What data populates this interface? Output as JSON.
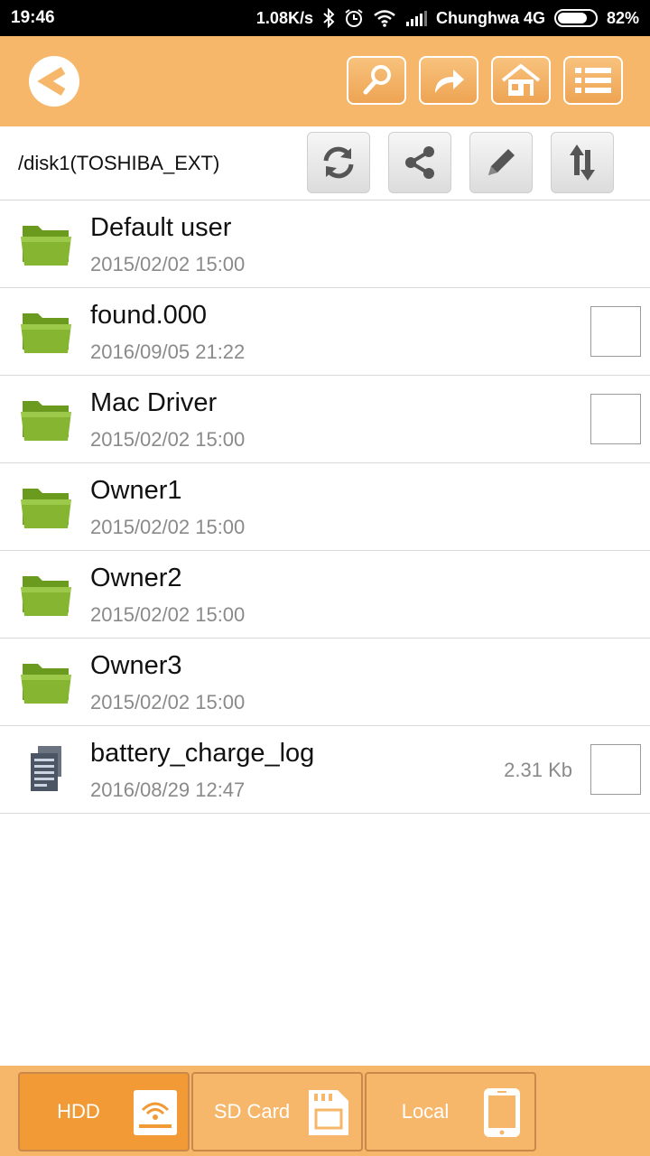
{
  "status": {
    "time": "19:46",
    "speed": "1.08K/s",
    "carrier": "Chunghwa 4G",
    "battery": "82%",
    "battery_level": 0.82
  },
  "toolbar": {
    "buttons": [
      {
        "name": "search-button",
        "icon": "key-icon"
      },
      {
        "name": "share-forward-button",
        "icon": "forward-arrow-icon"
      },
      {
        "name": "home-button",
        "icon": "home-icon"
      },
      {
        "name": "menu-list-button",
        "icon": "list-icon"
      }
    ]
  },
  "path": {
    "label": "/disk1(TOSHIBA_EXT)"
  },
  "files": [
    {
      "name": "Default user",
      "date": "2015/02/02 15:00",
      "type": "folder",
      "checkbox": false,
      "size": ""
    },
    {
      "name": "found.000",
      "date": "2016/09/05 21:22",
      "type": "folder",
      "checkbox": true,
      "size": ""
    },
    {
      "name": "Mac Driver",
      "date": "2015/02/02 15:00",
      "type": "folder",
      "checkbox": true,
      "size": ""
    },
    {
      "name": "Owner1",
      "date": "2015/02/02 15:00",
      "type": "folder",
      "checkbox": false,
      "size": ""
    },
    {
      "name": "Owner2",
      "date": "2015/02/02 15:00",
      "type": "folder",
      "checkbox": false,
      "size": ""
    },
    {
      "name": "Owner3",
      "date": "2015/02/02 15:00",
      "type": "folder",
      "checkbox": false,
      "size": ""
    },
    {
      "name": "battery_charge_log",
      "date": "2016/08/29 12:47",
      "type": "file",
      "checkbox": true,
      "size": "2.31 Kb"
    }
  ],
  "tabs": [
    {
      "label": "HDD",
      "active": true
    },
    {
      "label": "SD Card",
      "active": false
    },
    {
      "label": "Local",
      "active": false
    }
  ],
  "colors": {
    "accent": "#f6b76a",
    "active_tab": "#f29b36",
    "folder": "#7aa82a"
  }
}
